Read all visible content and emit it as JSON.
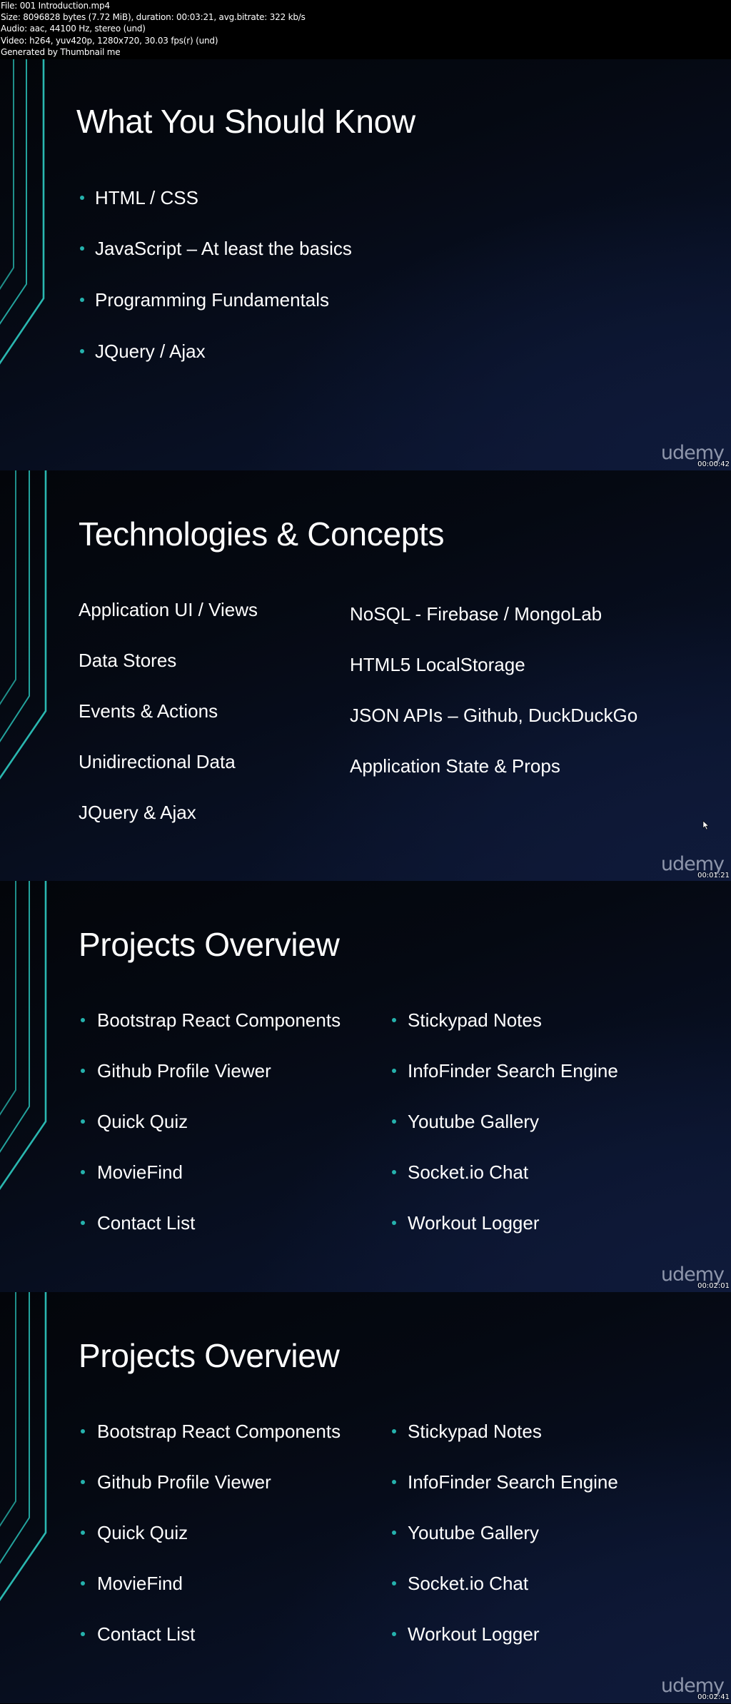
{
  "header": {
    "lines": [
      "File: 001 Introduction.mp4",
      "Size: 8096828 bytes (7.72 MiB), duration: 00:03:21, avg.bitrate: 322 kb/s",
      "Audio: aac, 44100 Hz, stereo (und)",
      "Video: h264, yuv420p, 1280x720, 30.03 fps(r) (und)",
      "Generated by Thumbnail me"
    ]
  },
  "brand": {
    "logo_text": "udemy",
    "accent_color": "#25b2ad",
    "logo_color": "#8e96ab"
  },
  "slides": [
    {
      "title": "What You Should Know",
      "timestamp": "00:00:42",
      "bullets": [
        "HTML / CSS",
        "JavaScript – At least the basics",
        "Programming Fundamentals",
        "JQuery / Ajax"
      ]
    },
    {
      "title": "Technologies & Concepts",
      "timestamp": "00:01:21",
      "left": [
        "Application UI / Views",
        "Data Stores",
        "Events & Actions",
        "Unidirectional Data",
        "JQuery & Ajax"
      ],
      "right": [
        "NoSQL - Firebase / MongoLab",
        "HTML5 LocalStorage",
        "JSON APIs – Github, DuckDuckGo",
        "Application State & Props"
      ]
    },
    {
      "title": "Projects Overview",
      "timestamp": "00:02:01",
      "left": [
        "Bootstrap React Components",
        "Github Profile Viewer",
        "Quick Quiz",
        "MovieFind",
        "Contact List"
      ],
      "right": [
        "Stickypad Notes",
        "InfoFinder Search Engine",
        "Youtube Gallery",
        "Socket.io Chat",
        "Workout Logger"
      ]
    },
    {
      "title": "Projects Overview",
      "timestamp": "00:02:41",
      "left": [
        "Bootstrap React Components",
        "Github Profile Viewer",
        "Quick Quiz",
        "MovieFind",
        "Contact List"
      ],
      "right": [
        "Stickypad Notes",
        "InfoFinder Search Engine",
        "Youtube Gallery",
        "Socket.io Chat",
        "Workout Logger"
      ]
    }
  ]
}
